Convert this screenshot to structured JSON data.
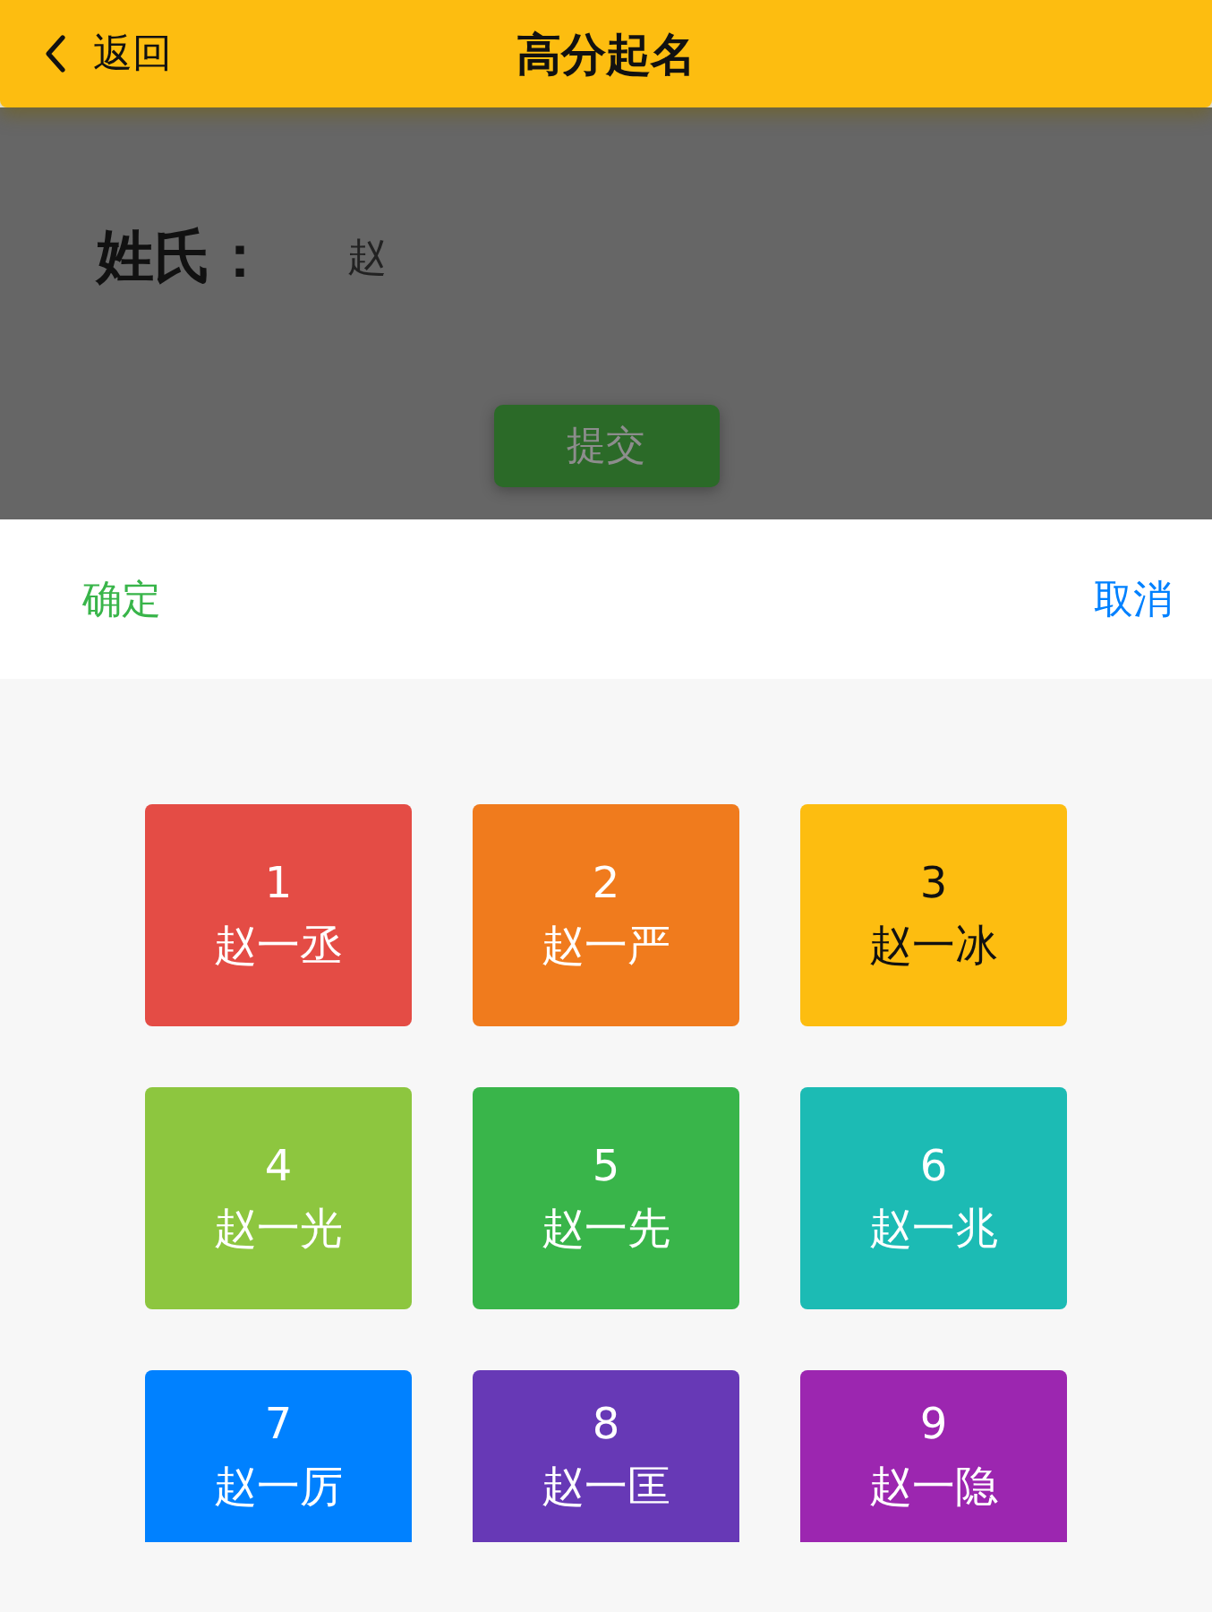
{
  "nav_bar": {
    "back_label": "返回",
    "title": "高分起名"
  },
  "form": {
    "surname_label": "姓氏：",
    "surname_value": "赵",
    "submit_label": "提交"
  },
  "picker": {
    "confirm": "确定",
    "cancel": "取消",
    "options": [
      {
        "number": "1",
        "name": "赵一丞",
        "color": "#e44c45",
        "dark_text": false
      },
      {
        "number": "2",
        "name": "赵一严",
        "color": "#f07b1d",
        "dark_text": false
      },
      {
        "number": "3",
        "name": "赵一冰",
        "color": "#fdbd10",
        "dark_text": true
      },
      {
        "number": "4",
        "name": "赵一光",
        "color": "#8dc63f",
        "dark_text": false
      },
      {
        "number": "5",
        "name": "赵一先",
        "color": "#39b54a",
        "dark_text": false
      },
      {
        "number": "6",
        "name": "赵一兆",
        "color": "#1cbbb4",
        "dark_text": false
      },
      {
        "number": "7",
        "name": "赵一厉",
        "color": "#0081ff",
        "dark_text": false
      },
      {
        "number": "8",
        "name": "赵一匡",
        "color": "#6739b6",
        "dark_text": false
      },
      {
        "number": "9",
        "name": "赵一隐",
        "color": "#9c26b0",
        "dark_text": false
      }
    ]
  }
}
